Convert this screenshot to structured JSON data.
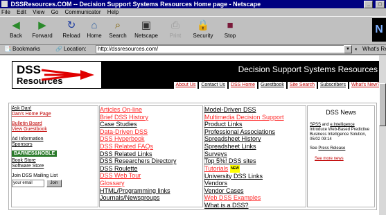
{
  "window": {
    "title": "DSSResources.COM -- Decision Support Systems Resources Home page - Netscape"
  },
  "menu": [
    "File",
    "Edit",
    "View",
    "Go",
    "Communicator",
    "Help"
  ],
  "toolbar": {
    "buttons": [
      {
        "label": "Back",
        "icon": "back-arrow-icon",
        "glyph": "◀"
      },
      {
        "label": "Forward",
        "icon": "forward-arrow-icon",
        "glyph": "▶"
      },
      {
        "label": "Reload",
        "icon": "reload-icon",
        "glyph": "↻"
      },
      {
        "label": "Home",
        "icon": "home-icon",
        "glyph": "⌂"
      },
      {
        "label": "Search",
        "icon": "search-icon",
        "glyph": "⌕"
      },
      {
        "label": "Netscape",
        "icon": "netscape-icon",
        "glyph": "▣"
      },
      {
        "label": "Print",
        "icon": "print-icon",
        "glyph": "⎙"
      },
      {
        "label": "Security",
        "icon": "lock-icon",
        "glyph": "🔒"
      },
      {
        "label": "Stop",
        "icon": "stop-icon",
        "glyph": "■"
      }
    ]
  },
  "location": {
    "bookmarks_label": "Bookmarks",
    "location_label": "Location:",
    "url": "http://dssresources.com/",
    "related_label": "What's Related"
  },
  "page": {
    "logo": {
      "line1": "DSS",
      "line2": "Resources"
    },
    "banner_title": "Decision Support Systems Resources",
    "nav": [
      "About Us",
      "Contact Us",
      "DSS Home",
      "Guestbook",
      "Site Search",
      "Subscribers",
      "What's New?"
    ],
    "col1": {
      "ask1": "Ask Dan!",
      "ask2": "Dan's Home Page",
      "bb1": "Bulletin Board",
      "bb2": "View Guestbook",
      "ad1": "Ad Information",
      "ad2": "Sponsors",
      "bn": "BARNES&NOBLE",
      "store1": "Book Store",
      "store2": "Software Store",
      "join": "Join DSS Mailing List",
      "email_value": "your email",
      "join_btn": "Join"
    },
    "col2": [
      {
        "t": "Articles On-line",
        "red": true
      },
      {
        "t": "Brief DSS History",
        "red": true
      },
      {
        "t": "Case Studies",
        "red": false
      },
      {
        "t": "Data-Driven DSS",
        "red": true
      },
      {
        "t": "DSS Hyperbook",
        "red": true
      },
      {
        "t": "DSS Related FAQs",
        "red": true
      },
      {
        "t": "DSS Related Links",
        "red": false
      },
      {
        "t": "DSS Researchers Directory",
        "red": false
      },
      {
        "t": "DSS Roulette",
        "red": false
      },
      {
        "t": "DSS Web Tour",
        "red": true
      },
      {
        "t": "Glossary",
        "red": true
      },
      {
        "t": "HTML/Programming links",
        "red": false
      },
      {
        "t": "Journals/Newsgroups",
        "red": false
      }
    ],
    "col3": [
      {
        "t": "Model-Driven DSS",
        "red": false
      },
      {
        "t": "Multimedia Decision Support",
        "red": true
      },
      {
        "t": "Product Links",
        "red": false
      },
      {
        "t": "Professional Associations",
        "red": false
      },
      {
        "t": "Spreadsheet History",
        "red": false
      },
      {
        "t": "Spreadsheet Links",
        "red": false
      },
      {
        "t": "Surveys",
        "red": false
      },
      {
        "t": "Top 5%! DSS sites",
        "red": false
      },
      {
        "t": "Tutorials",
        "red": true,
        "badge": "NEW"
      },
      {
        "t": "University DSS Links",
        "red": false
      },
      {
        "t": "Vendors",
        "red": false
      },
      {
        "t": "Vendor Cases",
        "red": false
      },
      {
        "t": "Web DSS Examples",
        "red": true
      },
      {
        "t": "What is a DSS?",
        "red": false
      }
    ],
    "news": {
      "title": "DSS News",
      "spss": "SPSS",
      "and": "and",
      "eint": "e.Intelligence",
      "body": "Introduce Web-Based Predictive Business Intelligence Solution, 05/02 09:14",
      "see": "See",
      "press": "Press Release",
      "more": "See more news"
    }
  }
}
